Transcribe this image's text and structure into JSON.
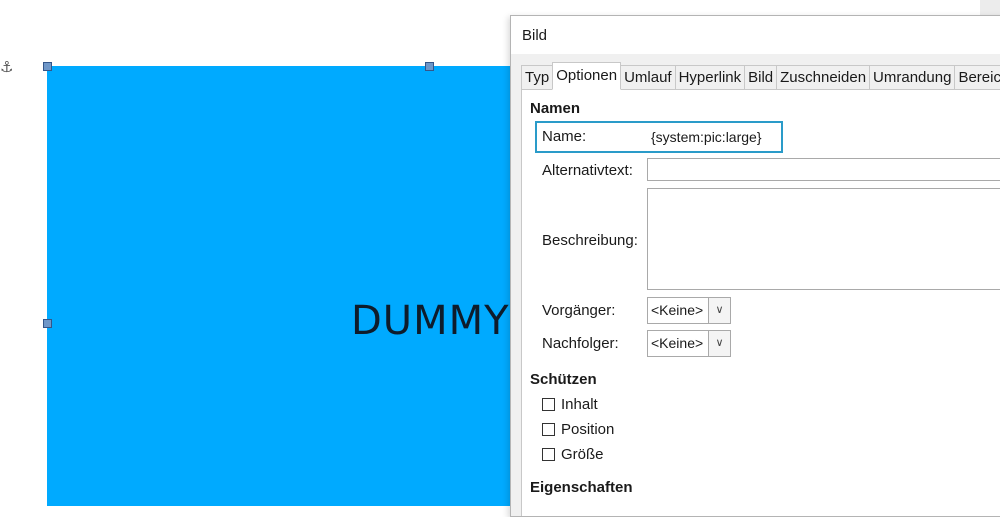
{
  "document": {
    "anchor_icon": "anchor-icon",
    "image_text": "DUMMY",
    "image_color": "#00aaff"
  },
  "dialog": {
    "title": "Bild",
    "tabs": [
      "Typ",
      "Optionen",
      "Umlauf",
      "Hyperlink",
      "Bild",
      "Zuschneiden",
      "Umrandung",
      "Bereich"
    ],
    "active_tab": "Optionen",
    "sections": {
      "names": {
        "heading": "Namen",
        "name_label": "Name:",
        "name_value": "{system:pic:large}",
        "alt_label": "Alternativtext:",
        "alt_value": "",
        "desc_label": "Beschreibung:",
        "desc_value": "",
        "prev_label": "Vorgänger:",
        "prev_value": "<Keine>",
        "next_label": "Nachfolger:",
        "next_value": "<Keine>"
      },
      "protect": {
        "heading": "Schützen",
        "content_label": "Inhalt",
        "position_label": "Position",
        "size_label": "Größe"
      },
      "properties": {
        "heading": "Eigenschaften"
      }
    }
  },
  "colors": {
    "focus_accent": "#2a9bc9"
  }
}
